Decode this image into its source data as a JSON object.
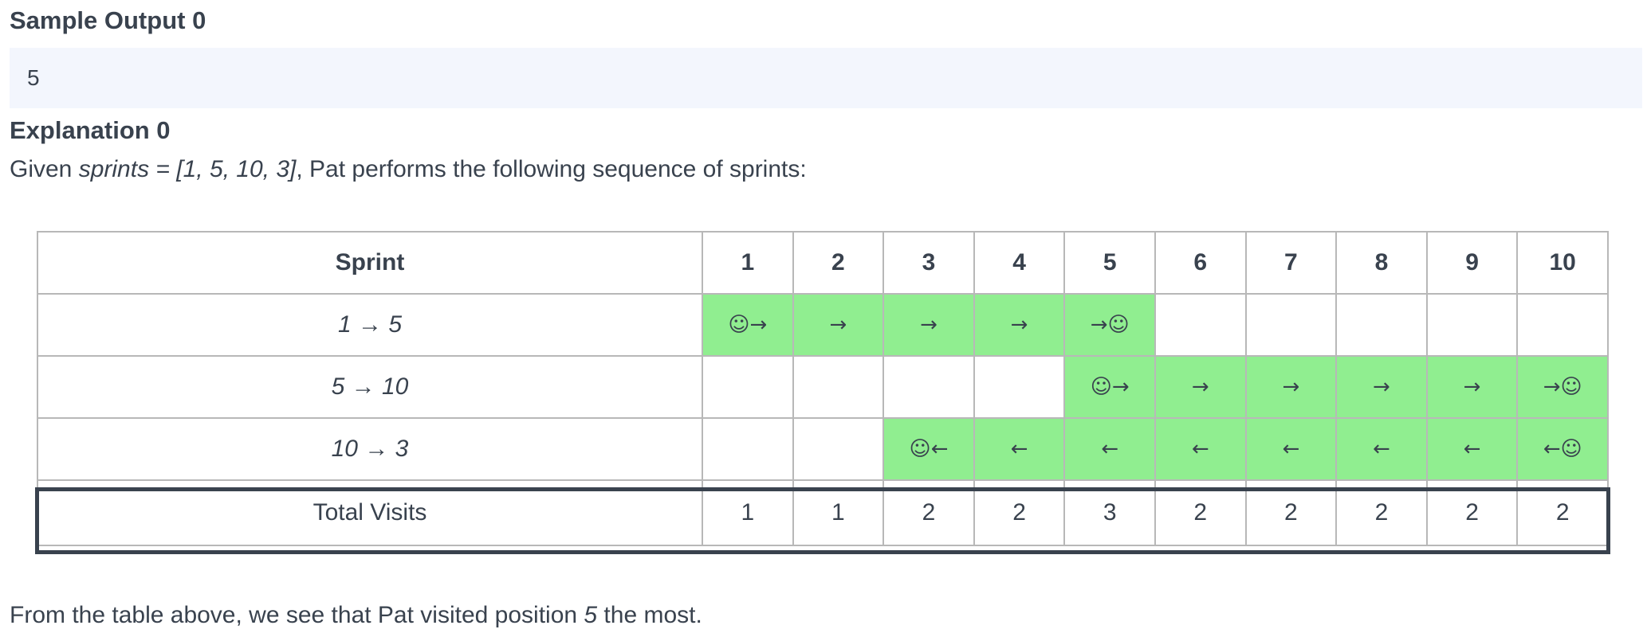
{
  "sample_output": {
    "title": "Sample Output 0",
    "value": "5"
  },
  "explanation": {
    "title": "Explanation 0",
    "given_prefix": "Given ",
    "given_var": "sprints = [1, 5, 10, 3]",
    "given_suffix": ", Pat performs the following sequence of sprints:",
    "conclusion_prefix": "From the table above, we see that Pat visited position ",
    "conclusion_value": "5",
    "conclusion_suffix": " the most."
  },
  "table": {
    "corner_header": "Sprint",
    "columns": [
      "1",
      "2",
      "3",
      "4",
      "5",
      "6",
      "7",
      "8",
      "9",
      "10"
    ],
    "rows": [
      {
        "label": "1 → 5",
        "cells": [
          "☺→",
          "→",
          "→",
          "→",
          "→☺",
          "",
          "",
          "",
          "",
          ""
        ],
        "highlight": [
          true,
          true,
          true,
          true,
          true,
          false,
          false,
          false,
          false,
          false
        ]
      },
      {
        "label": "5 → 10",
        "cells": [
          "",
          "",
          "",
          "",
          "☺→",
          "→",
          "→",
          "→",
          "→",
          "→☺"
        ],
        "highlight": [
          false,
          false,
          false,
          false,
          true,
          true,
          true,
          true,
          true,
          true
        ]
      },
      {
        "label": "10 → 3",
        "cells": [
          "",
          "",
          "☺←",
          "←",
          "←",
          "←",
          "←",
          "←",
          "←",
          "←☺"
        ],
        "highlight": [
          false,
          false,
          true,
          true,
          true,
          true,
          true,
          true,
          true,
          true
        ]
      }
    ],
    "total_label": "Total Visits",
    "totals": [
      "1",
      "1",
      "2",
      "2",
      "3",
      "2",
      "2",
      "2",
      "2",
      "2"
    ]
  },
  "colors": {
    "highlight": "#90ee90",
    "output_bg": "#f3f6fd",
    "text": "#39424e",
    "grid": "#b8b8b8"
  }
}
